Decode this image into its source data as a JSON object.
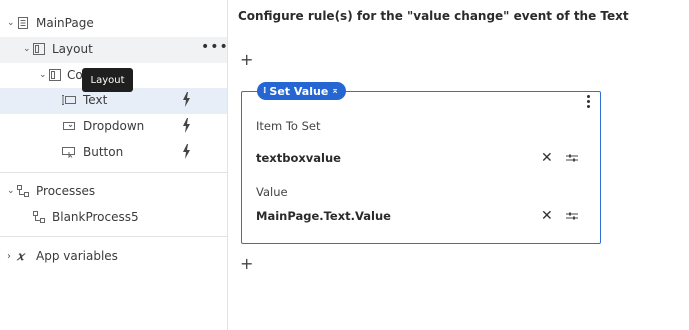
{
  "sidebar": {
    "items": [
      {
        "label": "MainPage"
      },
      {
        "label": "Layout"
      },
      {
        "label": "Co"
      },
      {
        "label": "Text"
      },
      {
        "label": "Dropdown"
      },
      {
        "label": "Button"
      },
      {
        "label": "Processes"
      },
      {
        "label": "BlankProcess5"
      },
      {
        "label": "App variables"
      }
    ],
    "more_menu": "•••",
    "tooltip": "Layout",
    "app_variables_icon": "𝑥"
  },
  "main": {
    "title": "Configure rule(s) for the \"value change\" event of the Text",
    "add_symbol": "+",
    "action": {
      "badge_label": "Set Value",
      "grip": "⁞",
      "collapse": "⌅",
      "item_label": "Item To Set",
      "item_value": "textboxvalue",
      "value_label": "Value",
      "value_value": "MainPage.Text.Value",
      "clear_symbol": "✕"
    }
  }
}
